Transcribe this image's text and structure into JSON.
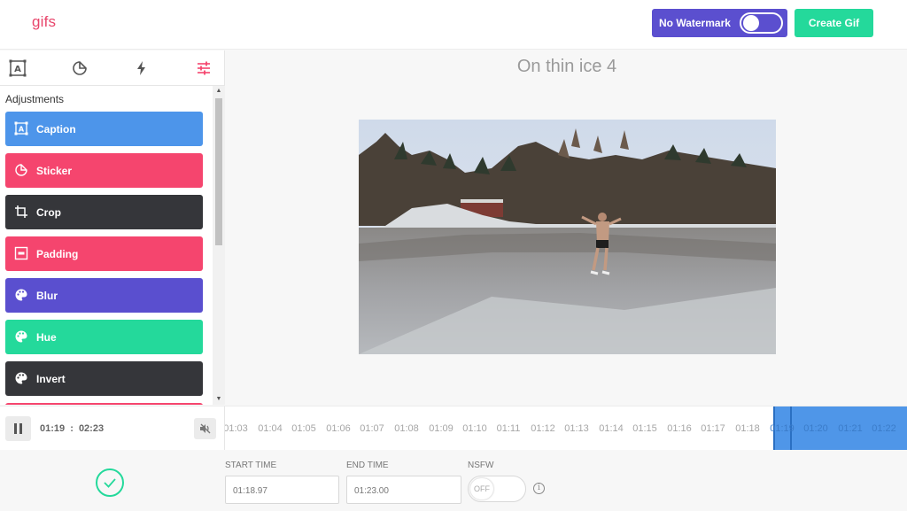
{
  "header": {
    "logo": "gifs",
    "watermark_label": "No Watermark",
    "watermark_enabled": true,
    "create_label": "Create Gif"
  },
  "colors": {
    "brand_pink": "#e8456b",
    "watermark_purple": "#5b4fcf",
    "create_green": "#24d99b",
    "selection_blue": "#4f96e8"
  },
  "sidebar": {
    "tab_icons": [
      "caption-icon",
      "sticker-icon",
      "flash-icon",
      "adjustments-icon"
    ],
    "active_tab": "adjustments",
    "panel_title": "Adjustments",
    "tools": [
      {
        "label": "Caption",
        "icon": "caption-icon",
        "color": "#4d95ea"
      },
      {
        "label": "Sticker",
        "icon": "sticker-icon",
        "color": "#f5456e"
      },
      {
        "label": "Crop",
        "icon": "crop-icon",
        "color": "#35363a"
      },
      {
        "label": "Padding",
        "icon": "padding-icon",
        "color": "#f5456e"
      },
      {
        "label": "Blur",
        "icon": "palette-icon",
        "color": "#5a4fcf"
      },
      {
        "label": "Hue",
        "icon": "palette-icon",
        "color": "#24d99b"
      },
      {
        "label": "Invert",
        "icon": "palette-icon",
        "color": "#35363a"
      }
    ]
  },
  "main": {
    "video_title": "On thin ice 4"
  },
  "player": {
    "current_time": "01:19",
    "separator": ":",
    "duration": "02:23"
  },
  "timeline": {
    "ticks": [
      "01:03",
      "01:04",
      "01:05",
      "01:06",
      "01:07",
      "01:08",
      "01:09",
      "01:10",
      "01:11",
      "01:12",
      "01:13",
      "01:14",
      "01:15",
      "01:16",
      "01:17",
      "01:18"
    ],
    "selected_ticks": [
      "01:19",
      "01:20",
      "01:21",
      "01:22"
    ]
  },
  "form": {
    "start_label": "START TIME",
    "start_value": "01:18.97",
    "end_label": "END TIME",
    "end_value": "01:23.00",
    "nsfw_label": "NSFW",
    "nsfw_state": "OFF",
    "info_glyph": "i"
  }
}
